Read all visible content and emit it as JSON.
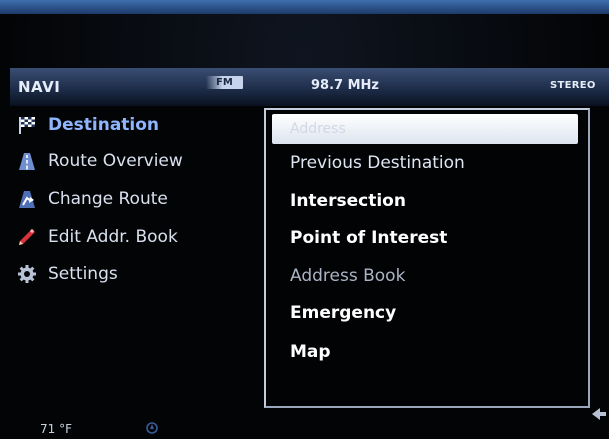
{
  "status_bar": {
    "title": "NAVI",
    "band": "FM",
    "frequency": "98.7 MHz",
    "stereo": "STEREO"
  },
  "left_menu": {
    "items": [
      {
        "label": "Destination",
        "icon": "checkered-flag-icon",
        "selected": true
      },
      {
        "label": "Route Overview",
        "icon": "road-icon",
        "selected": false
      },
      {
        "label": "Change Route",
        "icon": "route-arrow-icon",
        "selected": false
      },
      {
        "label": "Edit Addr. Book",
        "icon": "pencil-icon",
        "selected": false
      },
      {
        "label": "Settings",
        "icon": "gear-icon",
        "selected": false
      }
    ]
  },
  "destination_menu": {
    "items": [
      {
        "label": "Address",
        "state": "highlighted"
      },
      {
        "label": "Previous Destination",
        "state": "normal"
      },
      {
        "label": "Intersection",
        "state": "bold"
      },
      {
        "label": "Point of Interest",
        "state": "bold"
      },
      {
        "label": "Address Book",
        "state": "dim"
      },
      {
        "label": "Emergency",
        "state": "bold"
      },
      {
        "label": "Map",
        "state": "bold"
      }
    ]
  },
  "bottom_bar": {
    "temperature": "71 °F"
  },
  "colors": {
    "accent": "#8fb5ff",
    "status_bar": "#2a3b5c",
    "panel_border": "#c2ccde",
    "top_band": "#2d5593"
  }
}
